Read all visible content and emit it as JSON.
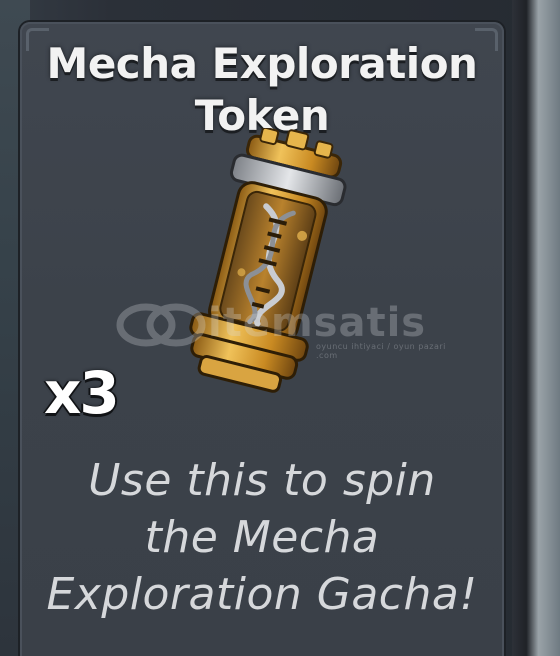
{
  "item": {
    "title_line1": "Mecha Exploration",
    "title_line2": "Token",
    "quantity": "x3",
    "description_line1": "Use this to spin",
    "description_line2": "the Mecha",
    "description_line3": "Exploration Gacha!",
    "icon": "mecha-token-capsule-icon"
  },
  "watermark": {
    "text": "itemsatis",
    "subtext": "oyuncu ihtiyaci / oyun pazari .com"
  },
  "colors": {
    "card_background": "#3c424a",
    "title_text": "#f2f2f2",
    "description_text": "#d6d8db",
    "token_gold": "#d9a441"
  }
}
